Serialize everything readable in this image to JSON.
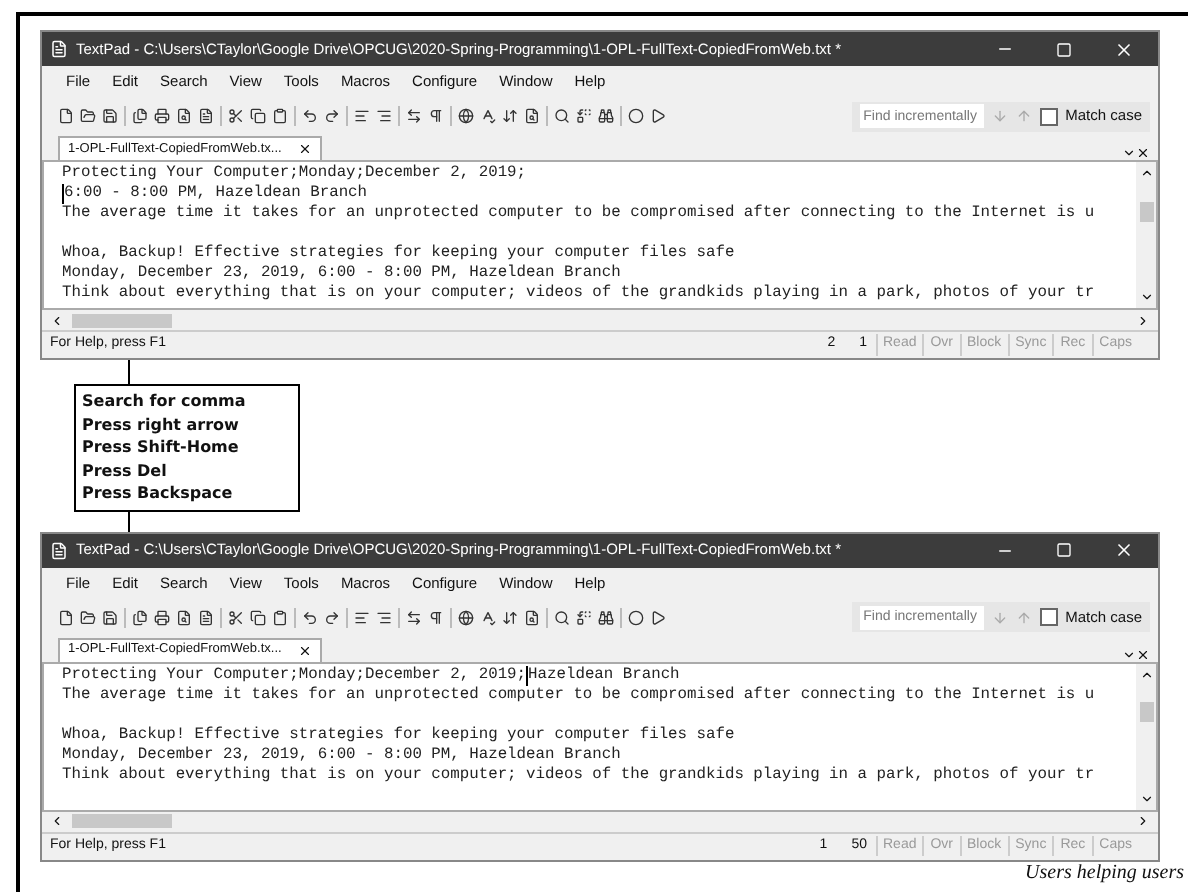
{
  "windows": [
    {
      "title": "TextPad - C:\\Users\\CTaylor\\Google Drive\\OPCUG\\2020-Spring-Programming\\1-OPL-FullText-CopiedFromWeb.txt *",
      "menu": [
        "File",
        "Edit",
        "Search",
        "View",
        "Tools",
        "Macros",
        "Configure",
        "Window",
        "Help"
      ],
      "find": {
        "placeholder": "Find incrementally"
      },
      "match_case": {
        "label": "Match case",
        "checked": false
      },
      "tab": {
        "label": "1-OPL-FullText-CopiedFromWeb.tx..."
      },
      "lines": [
        {
          "text": "Protecting Your Computer;Monday;December 2, 2019;"
        },
        {
          "kind": "cursor",
          "after": "6:00 - 8:00 PM, Hazeldean Branch"
        },
        {
          "text": "The average time it takes for an unprotected computer to be compromised after connecting to the Internet is u"
        },
        {
          "kind": "blank"
        },
        {
          "text": "Whoa, Backup! Effective strategies for keeping your computer files safe"
        },
        {
          "text": "Monday, December 23, 2019, 6:00 - 8:00 PM, Hazeldean Branch"
        },
        {
          "text": "Think about everything that is on your computer; videos of the grandkids playing in a park, photos of your tr"
        }
      ],
      "status": {
        "help": "For Help, press F1",
        "line": "2",
        "column": "1",
        "indicators": [
          "Read",
          "Ovr",
          "Block",
          "Sync",
          "Rec",
          "Caps"
        ]
      }
    },
    {
      "title": "TextPad - C:\\Users\\CTaylor\\Google Drive\\OPCUG\\2020-Spring-Programming\\1-OPL-FullText-CopiedFromWeb.txt *",
      "menu": [
        "File",
        "Edit",
        "Search",
        "View",
        "Tools",
        "Macros",
        "Configure",
        "Window",
        "Help"
      ],
      "find": {
        "placeholder": "Find incrementally"
      },
      "match_case": {
        "label": "Match case",
        "checked": false
      },
      "tab": {
        "label": "1-OPL-FullText-CopiedFromWeb.tx..."
      },
      "lines": [
        {
          "kind": "cursor",
          "before": "Protecting Your Computer;Monday;December 2, 2019;",
          "after": "Hazeldean Branch"
        },
        {
          "text": "The average time it takes for an unprotected computer to be compromised after connecting to the Internet is u"
        },
        {
          "kind": "blank"
        },
        {
          "text": "Whoa, Backup! Effective strategies for keeping your computer files safe"
        },
        {
          "text": "Monday, December 23, 2019, 6:00 - 8:00 PM, Hazeldean Branch"
        },
        {
          "text": "Think about everything that is on your computer; videos of the grandkids playing in a park, photos of your tr"
        }
      ],
      "status": {
        "help": "For Help, press F1",
        "line": "1",
        "column": "50",
        "indicators": [
          "Read",
          "Ovr",
          "Block",
          "Sync",
          "Rec",
          "Caps"
        ]
      }
    }
  ],
  "callout": {
    "lines": [
      "Search for comma",
      "Press right arrow",
      "Press Shift-Home",
      "Press Del",
      "Press Backspace"
    ]
  },
  "footer": {
    "tagline": "Users helping users"
  }
}
